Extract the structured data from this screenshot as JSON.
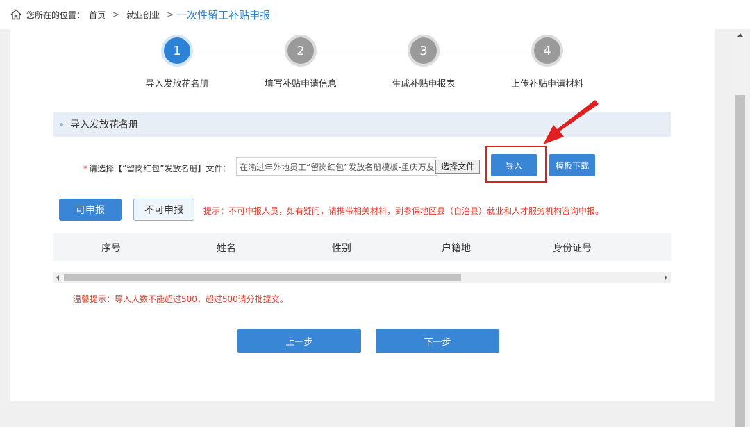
{
  "breadcrumb": {
    "prefix": "您所在的位置：",
    "home": "首页",
    "separator": ">",
    "level2": "就业创业",
    "current": "一次性留工补贴申报"
  },
  "steps": [
    {
      "number": "1",
      "label": "导入发放花名册",
      "active": true
    },
    {
      "number": "2",
      "label": "填写补贴申请信息",
      "active": false
    },
    {
      "number": "3",
      "label": "生成补贴申报表",
      "active": false
    },
    {
      "number": "4",
      "label": "上传补贴申请材料",
      "active": false
    }
  ],
  "section": {
    "title": "导入发放花名册"
  },
  "file": {
    "required_mark": "*",
    "label": "请选择【“留岗红包”发放名册】文件：",
    "value": "在渝过年外地员工“留岗红包”发放名册模板-重庆万友人",
    "choose_button": "选择文件"
  },
  "actions": {
    "import_button": "导入",
    "template_button": "模板下载"
  },
  "tabs": {
    "eligible": "可申报",
    "ineligible": "不可申报"
  },
  "hint": "提示：不可申报人员，如有疑问，请携带相关材料，到参保地区县（自治县）就业和人才服务机构咨询申报。",
  "table": {
    "columns": [
      "序号",
      "姓名",
      "性别",
      "户籍地",
      "身份证号"
    ]
  },
  "warm_tip": "温馨提示：导入人数不能超过500，超过500请分批提交。",
  "nav": {
    "prev": "上一步",
    "next": "下一步"
  },
  "colors": {
    "primary": "#3a86d6",
    "breadcrumb_current": "#2b82c9",
    "warning_text": "#e23a2a",
    "annotation": "#e02020"
  }
}
